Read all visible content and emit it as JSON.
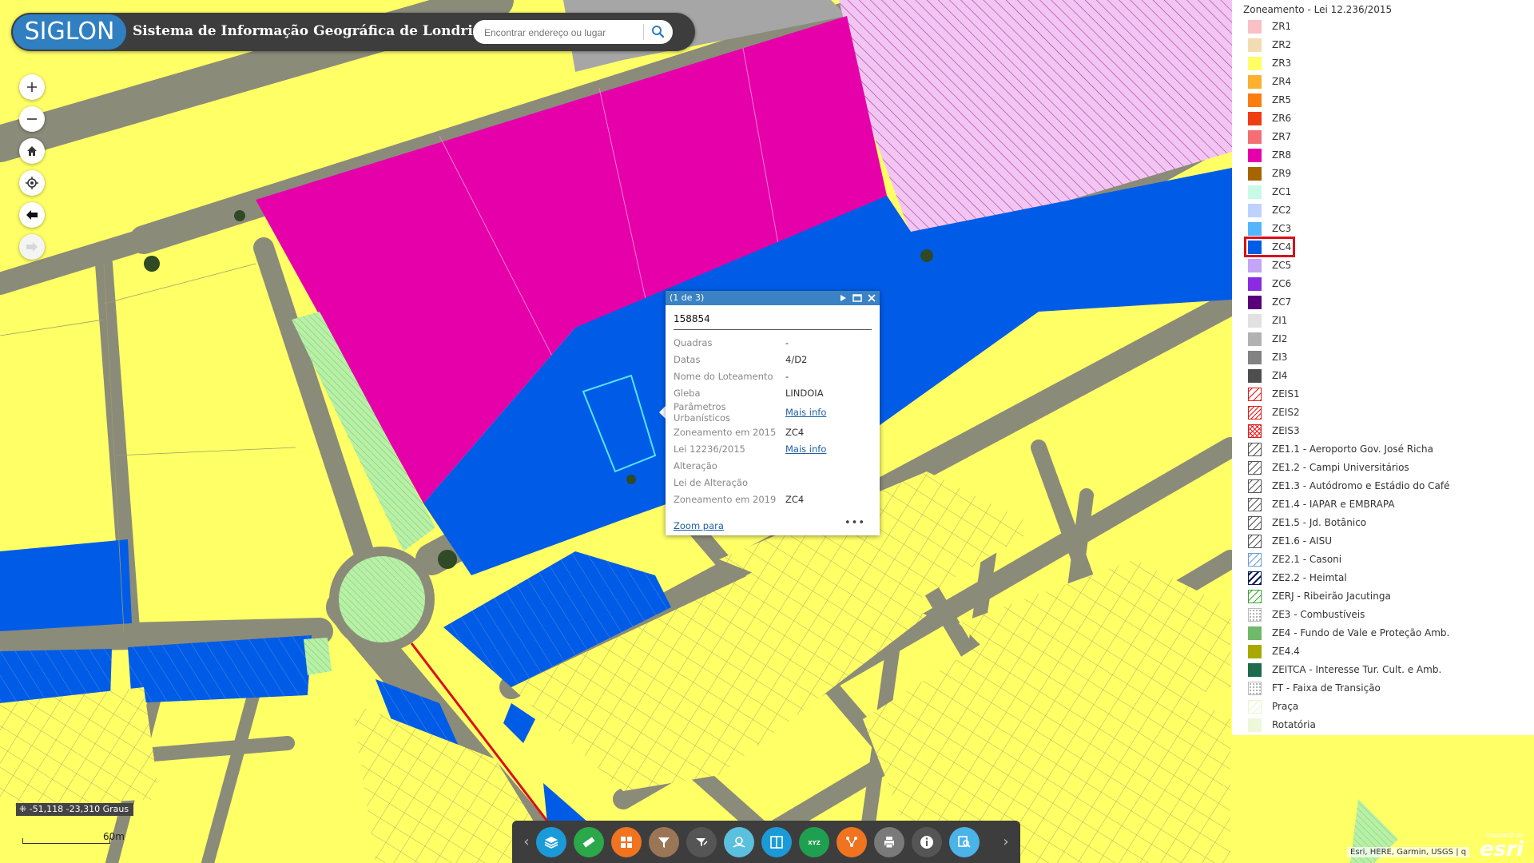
{
  "header": {
    "logo_text": "SIGLON",
    "title": "Sistema de Informação Geográfica de Londrina",
    "search_placeholder": "Encontrar endereço ou lugar",
    "search_icon": "search-icon"
  },
  "controls": [
    {
      "name": "zoom-in-button",
      "icon": "plus-icon"
    },
    {
      "name": "zoom-out-button",
      "icon": "minus-icon"
    },
    {
      "name": "home-button",
      "icon": "home-icon"
    },
    {
      "name": "locate-button",
      "icon": "crosshair-icon"
    },
    {
      "name": "back-extent-button",
      "icon": "arrow-left-icon"
    },
    {
      "name": "forward-extent-button",
      "icon": "arrow-right-icon"
    }
  ],
  "legend": {
    "title": "Zoneamento - Lei 12.236/2015",
    "highlighted": "ZC4",
    "items": [
      {
        "label": "ZR1",
        "color": "#f9c0c6",
        "pattern": "solid"
      },
      {
        "label": "ZR2",
        "color": "#f3dcb4",
        "pattern": "solid"
      },
      {
        "label": "ZR3",
        "color": "#ffff66",
        "pattern": "solid"
      },
      {
        "label": "ZR4",
        "color": "#fbb030",
        "pattern": "solid"
      },
      {
        "label": "ZR5",
        "color": "#fb7d12",
        "pattern": "solid"
      },
      {
        "label": "ZR6",
        "color": "#ee3d12",
        "pattern": "solid"
      },
      {
        "label": "ZR7",
        "color": "#f46f74",
        "pattern": "solid"
      },
      {
        "label": "ZR8",
        "color": "#e600a9",
        "pattern": "solid"
      },
      {
        "label": "ZR9",
        "color": "#a86400",
        "pattern": "solid"
      },
      {
        "label": "ZC1",
        "color": "#c8fae6",
        "pattern": "solid"
      },
      {
        "label": "ZC2",
        "color": "#bed2ff",
        "pattern": "solid"
      },
      {
        "label": "ZC3",
        "color": "#55b4ff",
        "pattern": "solid"
      },
      {
        "label": "ZC4",
        "color": "#005ce6",
        "pattern": "solid"
      },
      {
        "label": "ZC5",
        "color": "#c4a4f5",
        "pattern": "solid"
      },
      {
        "label": "ZC6",
        "color": "#8a2be2",
        "pattern": "solid"
      },
      {
        "label": "ZC7",
        "color": "#5a007a",
        "pattern": "solid"
      },
      {
        "label": "ZI1",
        "color": "#e1e1e1",
        "pattern": "solid"
      },
      {
        "label": "ZI2",
        "color": "#b2b2b2",
        "pattern": "solid"
      },
      {
        "label": "ZI3",
        "color": "#828282",
        "pattern": "solid"
      },
      {
        "label": "ZI4",
        "color": "#4e4e4e",
        "pattern": "solid"
      },
      {
        "label": "ZEIS1",
        "color": "#e31a1c",
        "pattern": "hatch"
      },
      {
        "label": "ZEIS2",
        "color": "#e31a1c",
        "pattern": "hatch-dense"
      },
      {
        "label": "ZEIS3",
        "color": "#e31a1c",
        "pattern": "cross"
      },
      {
        "label": "ZE1.1 - Aeroporto Gov. José Richa",
        "color": "#555555",
        "pattern": "hatch"
      },
      {
        "label": "ZE1.2 - Campi Universitários",
        "color": "#555555",
        "pattern": "hatch"
      },
      {
        "label": "ZE1.3 - Autódromo e Estádio do Café",
        "color": "#555555",
        "pattern": "hatch"
      },
      {
        "label": "ZE1.4 - IAPAR e EMBRAPA",
        "color": "#555555",
        "pattern": "hatch"
      },
      {
        "label": "ZE1.5 - Jd. Botânico",
        "color": "#555555",
        "pattern": "hatch"
      },
      {
        "label": "ZE1.6 - AISU",
        "color": "#555555",
        "pattern": "hatch"
      },
      {
        "label": "ZE2.1 - Casoni",
        "color": "#6a9be0",
        "pattern": "hatch"
      },
      {
        "label": "ZE2.2 - Heimtal",
        "color": "#0a1a55",
        "pattern": "hatch-bold"
      },
      {
        "label": "ZERJ - Ribeirão Jacutinga",
        "color": "#3aa636",
        "pattern": "hatch"
      },
      {
        "label": "ZE3 - Combustíveis",
        "color": "#999999",
        "pattern": "dots"
      },
      {
        "label": "ZE4 - Fundo de Vale e Proteção Amb.",
        "color": "#70b86a",
        "pattern": "solid"
      },
      {
        "label": "ZE4.4",
        "color": "#a8a800",
        "pattern": "solid"
      },
      {
        "label": "ZEITCA - Interesse Tur. Cult. e Amb.",
        "color": "#1e6b4e",
        "pattern": "solid"
      },
      {
        "label": "FT - Faixa de Transição",
        "color": "#999999",
        "pattern": "dots"
      },
      {
        "label": "Praça",
        "color": "#e9f5cf",
        "pattern": "hatch-light"
      },
      {
        "label": "Rotatória",
        "color": "#eef7d9",
        "pattern": "solid"
      }
    ]
  },
  "popup": {
    "count": "(1 de 3)",
    "title": "158854",
    "attributes": [
      {
        "key": "Quadras",
        "value": "-"
      },
      {
        "key": "Datas",
        "value": "4/D2"
      },
      {
        "key": "Nome do Loteamento",
        "value": "-"
      },
      {
        "key": "Gleba",
        "value": "LINDOIA"
      },
      {
        "key": "Parâmetros Urbanísticos",
        "value": "Mais info",
        "link": true
      },
      {
        "key": "Zoneamento em 2015",
        "value": "ZC4"
      },
      {
        "key": "Lei 12236/2015",
        "value": "Mais info",
        "link": true
      },
      {
        "key": "Alteração",
        "value": ""
      },
      {
        "key": "Lei de Alteração",
        "value": ""
      },
      {
        "key": "Zoneamento em 2019",
        "value": "ZC4"
      }
    ],
    "zoom_link": "Zoom para",
    "more_icon": "ellipsis-icon"
  },
  "coords": "-51,118 -23,310 Graus",
  "scale": "60m",
  "toolbar": [
    {
      "name": "layers",
      "color": "#1a9bd7"
    },
    {
      "name": "measure",
      "color": "#2aa84a"
    },
    {
      "name": "basemap-gallery",
      "color": "#f0731f"
    },
    {
      "name": "filter",
      "color": "#9b7656"
    },
    {
      "name": "query",
      "color": "#555555"
    },
    {
      "name": "cgi-tool",
      "color": "#5bc0de"
    },
    {
      "name": "swipe",
      "color": "#1a9bd7"
    },
    {
      "name": "coordinates",
      "color": "#1fa050"
    },
    {
      "name": "share",
      "color": "#f0731f"
    },
    {
      "name": "print",
      "color": "#7a7a7a"
    },
    {
      "name": "about",
      "color": "#555555"
    },
    {
      "name": "identify",
      "color": "#4ab3e8"
    }
  ],
  "attribution": "Esri, HERE, Garmin, USGS | q",
  "esri_powered": "POWERED BY",
  "esri_name": "esri"
}
